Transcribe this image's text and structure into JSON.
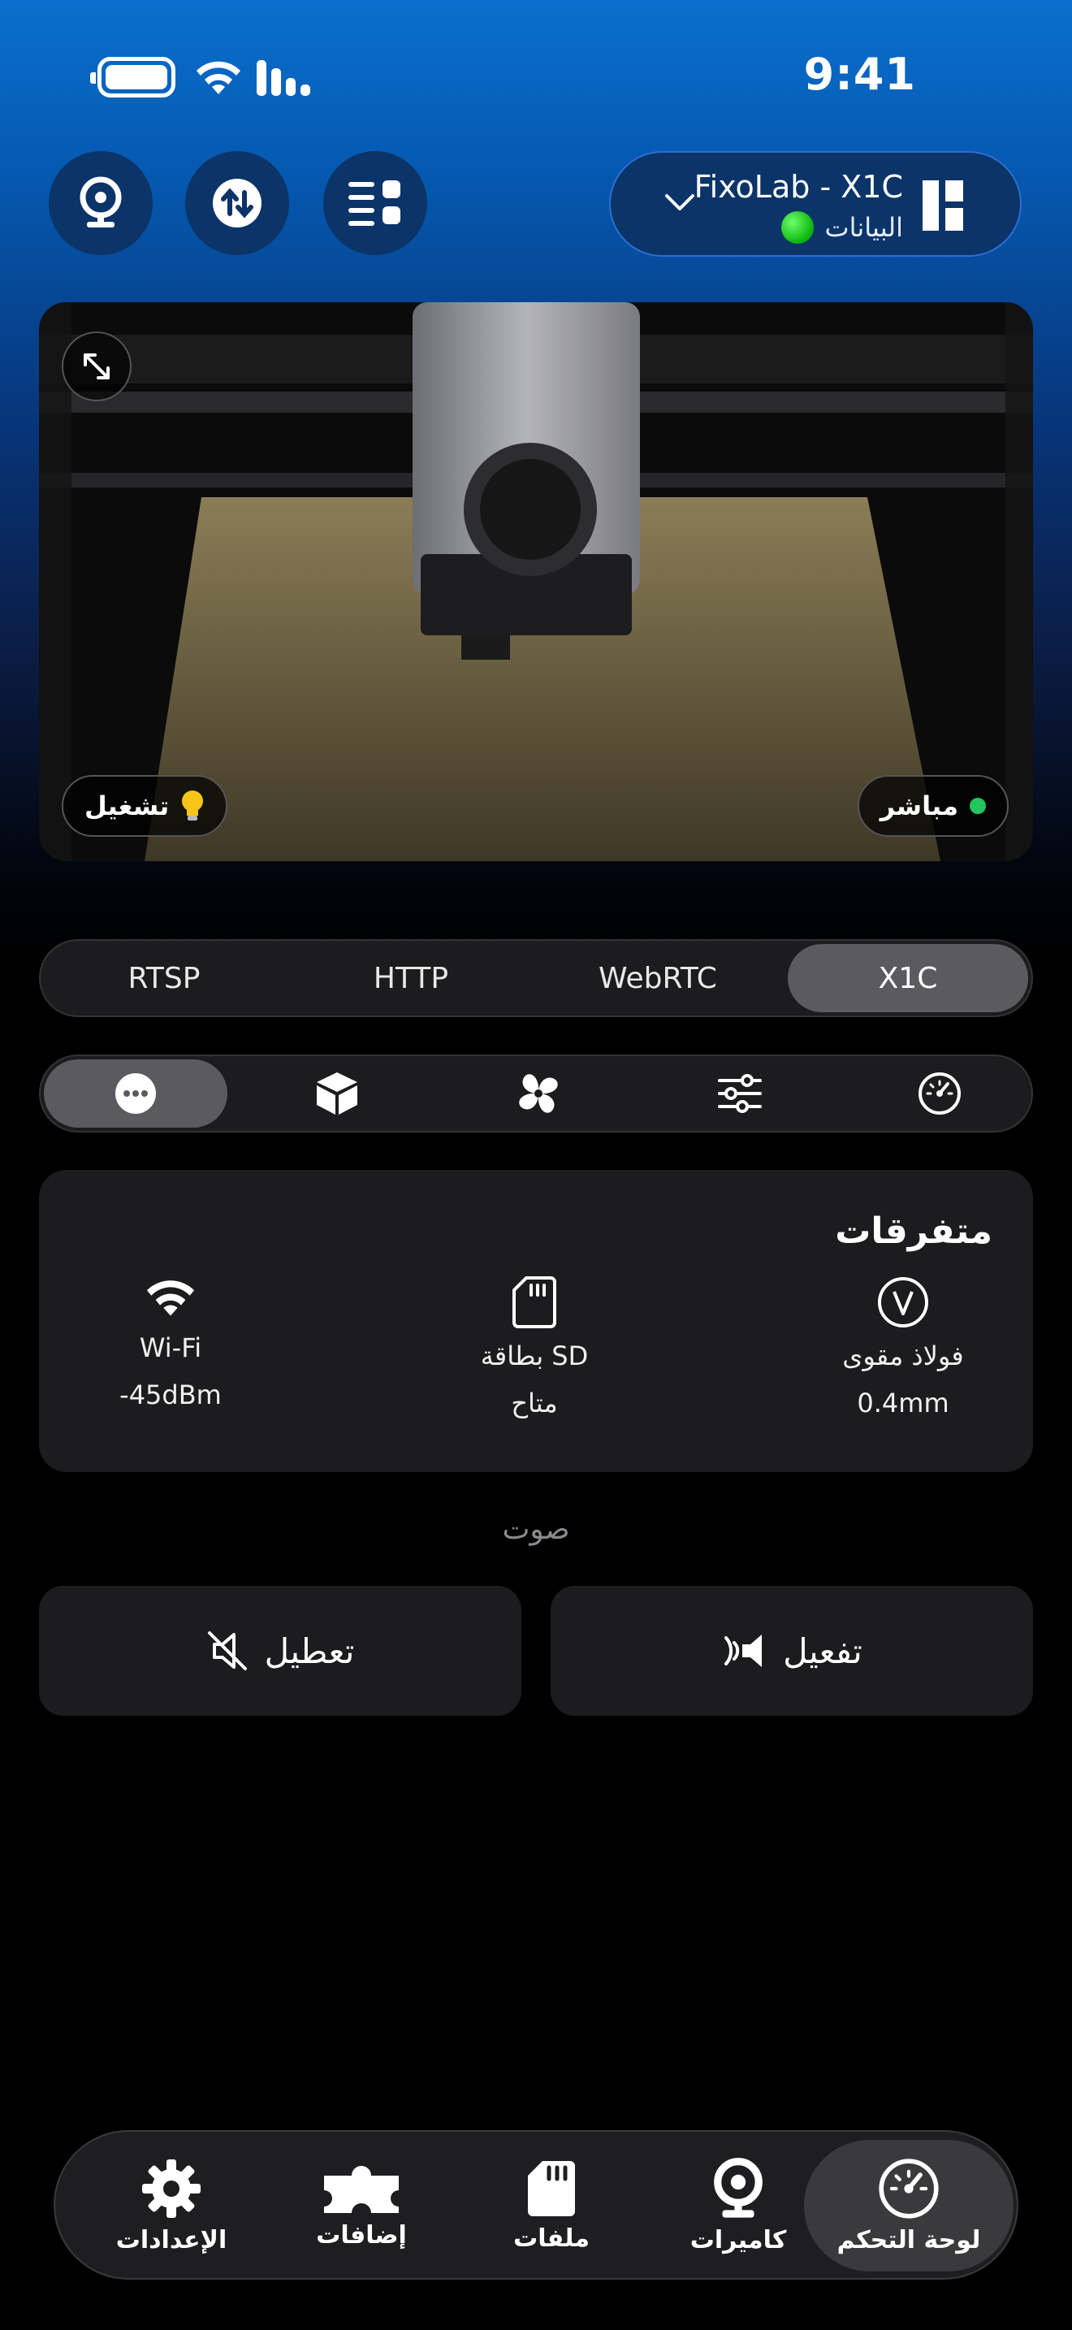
{
  "status_bar": {
    "time": "9:41"
  },
  "header": {
    "printer_name": "FixoLab - X1C",
    "printer_status": "البيانات"
  },
  "camera": {
    "live_label": "مباشر",
    "light_label": "تشغيل"
  },
  "stream_tabs": [
    {
      "label": "RTSP"
    },
    {
      "label": "HTTP"
    },
    {
      "label": "WebRTC"
    },
    {
      "label": "X1C",
      "active": true
    }
  ],
  "tool_tabs": [
    "more-icon",
    "box-icon",
    "fan-icon",
    "sliders-icon",
    "speedometer-icon"
  ],
  "misc": {
    "title": "متفرقات",
    "wifi": {
      "label": "Wi-Fi",
      "value": "-45dBm"
    },
    "sd": {
      "label": "بطاقة SD",
      "value": "متاح"
    },
    "nozzle": {
      "label": "فولاذ مقوى",
      "value": "0.4mm"
    }
  },
  "sound": {
    "label": "صوت",
    "disable": "تعطيل",
    "enable": "تفعيل"
  },
  "tabbar": [
    {
      "label": "الإعدادات",
      "icon": "gear-icon"
    },
    {
      "label": "إضافات",
      "icon": "puzzle-icon"
    },
    {
      "label": "ملفات",
      "icon": "sd-card-icon"
    },
    {
      "label": "كاميرات",
      "icon": "webcam-icon"
    },
    {
      "label": "لوحة التحكم",
      "icon": "dashboard-icon",
      "active": true
    }
  ],
  "colors": {
    "accent_blue": "#0a6fce",
    "live_green": "#22c55e",
    "active_segment": "#5b5b5f"
  }
}
